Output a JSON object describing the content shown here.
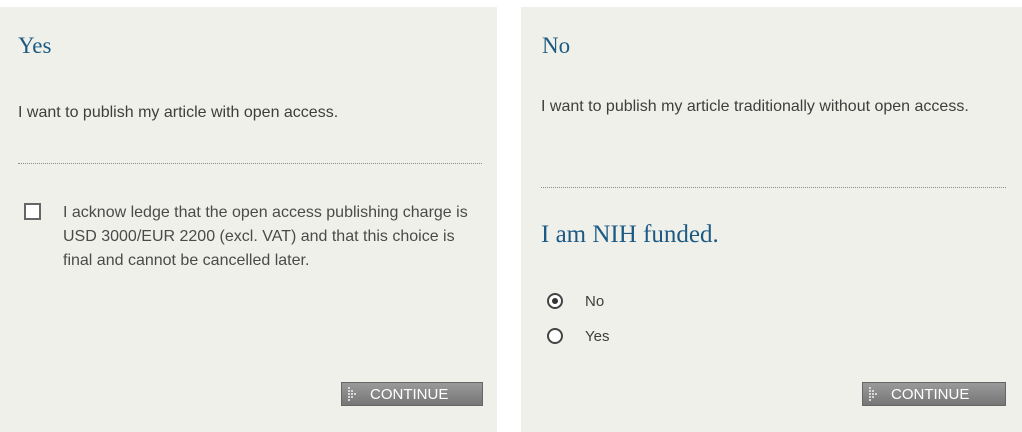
{
  "yes_panel": {
    "title": "Yes",
    "description": "I want to publish my article with open access.",
    "acknowledgement": "I acknow ledge that the open access publishing charge is USD 3000/EUR 2200 (excl. VAT) and that this choice is final and cannot be cancelled later.",
    "acknowledgement_checked": false,
    "continue_label": "CONTINUE"
  },
  "no_panel": {
    "title": "No",
    "description": "I want to publish my article traditionally without open access.",
    "nih_heading": "I am NIH funded.",
    "options": [
      {
        "label": "No",
        "checked": true
      },
      {
        "label": "Yes",
        "checked": false
      }
    ],
    "continue_label": "CONTINUE"
  },
  "colors": {
    "panel_bg": "#f0f0ea",
    "heading": "#1c5a84",
    "button": "#888888"
  },
  "icons": {
    "continue_icon": "dotted-arrow-icon"
  }
}
